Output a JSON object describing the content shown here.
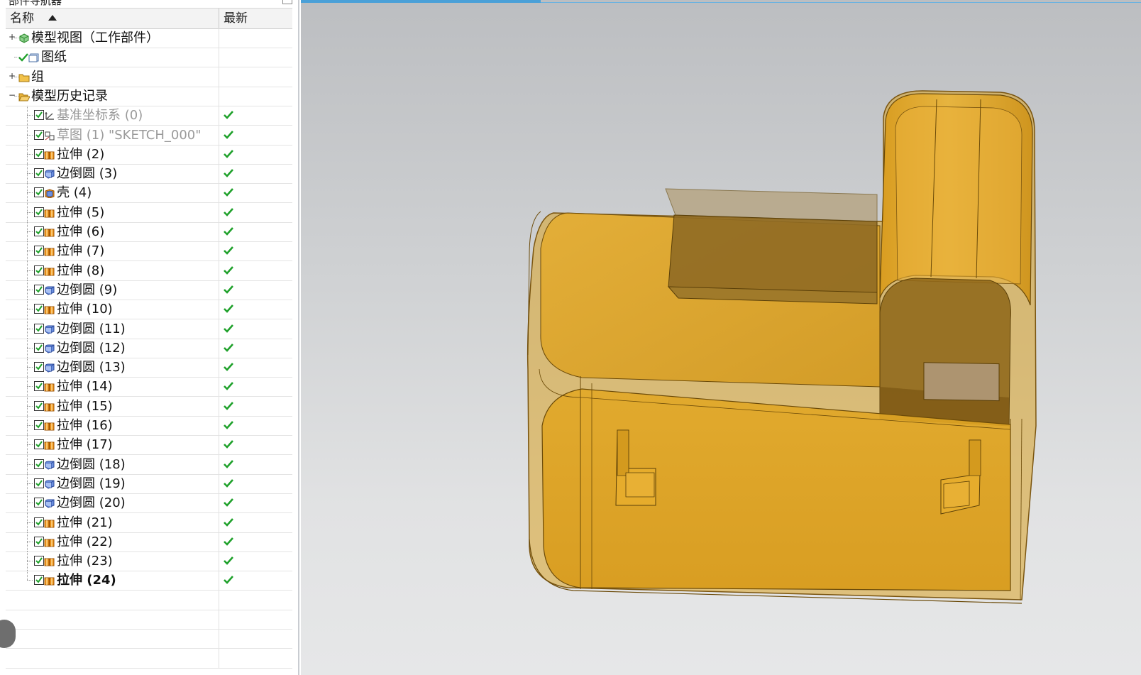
{
  "navigator": {
    "title": "部件导航器",
    "header": {
      "name": "名称",
      "latest": "最新"
    },
    "items": [
      {
        "label": "模型视图（工作部件）",
        "icon": "model-views-icon",
        "expander": "+",
        "indent": 0
      },
      {
        "label": "图纸",
        "icon": "drawing-icon",
        "expander": "",
        "indent": 0,
        "check": "green"
      },
      {
        "label": "组",
        "icon": "folder-icon",
        "expander": "+",
        "indent": 0
      },
      {
        "label": "模型历史记录",
        "icon": "folder-open-icon",
        "expander": "−",
        "indent": 0
      },
      {
        "label": "基准坐标系 (0)",
        "icon": "datum-csys-icon",
        "dim": true,
        "latest": true
      },
      {
        "label": "草图 (1) \"SKETCH_000\"",
        "icon": "sketch-icon",
        "dim": true,
        "latest": true
      },
      {
        "label": "拉伸 (2)",
        "icon": "extrude-icon",
        "latest": true
      },
      {
        "label": "边倒圆 (3)",
        "icon": "edge-blend-icon",
        "latest": true
      },
      {
        "label": "壳 (4)",
        "icon": "shell-icon",
        "latest": true
      },
      {
        "label": "拉伸 (5)",
        "icon": "extrude-icon",
        "latest": true
      },
      {
        "label": "拉伸 (6)",
        "icon": "extrude-icon",
        "latest": true
      },
      {
        "label": "拉伸 (7)",
        "icon": "extrude-icon",
        "latest": true
      },
      {
        "label": "拉伸 (8)",
        "icon": "extrude-icon",
        "latest": true
      },
      {
        "label": "边倒圆 (9)",
        "icon": "edge-blend-icon",
        "latest": true
      },
      {
        "label": "拉伸 (10)",
        "icon": "extrude-icon",
        "latest": true
      },
      {
        "label": "边倒圆 (11)",
        "icon": "edge-blend-icon",
        "latest": true
      },
      {
        "label": "边倒圆 (12)",
        "icon": "edge-blend-icon",
        "latest": true
      },
      {
        "label": "边倒圆 (13)",
        "icon": "edge-blend-icon",
        "latest": true
      },
      {
        "label": "拉伸 (14)",
        "icon": "extrude-icon",
        "latest": true
      },
      {
        "label": "拉伸 (15)",
        "icon": "extrude-icon",
        "latest": true
      },
      {
        "label": "拉伸 (16)",
        "icon": "extrude-icon",
        "latest": true
      },
      {
        "label": "拉伸 (17)",
        "icon": "extrude-icon",
        "latest": true
      },
      {
        "label": "边倒圆 (18)",
        "icon": "edge-blend-icon",
        "latest": true
      },
      {
        "label": "边倒圆 (19)",
        "icon": "edge-blend-icon",
        "latest": true
      },
      {
        "label": "边倒圆 (20)",
        "icon": "edge-blend-icon",
        "latest": true
      },
      {
        "label": "拉伸 (21)",
        "icon": "extrude-icon",
        "latest": true
      },
      {
        "label": "拉伸 (22)",
        "icon": "extrude-icon",
        "latest": true
      },
      {
        "label": "拉伸 (23)",
        "icon": "extrude-icon",
        "latest": true
      },
      {
        "label": "拉伸 (24)",
        "icon": "extrude-icon",
        "latest": true,
        "bold": true
      }
    ]
  },
  "viewport": {
    "model": "translucent-orange-part"
  },
  "colors": {
    "check_green": "#1fa12b",
    "part_fill": "#e2a31c",
    "part_edge": "#6b4a08",
    "tab_accent": "#4aa0d8"
  }
}
